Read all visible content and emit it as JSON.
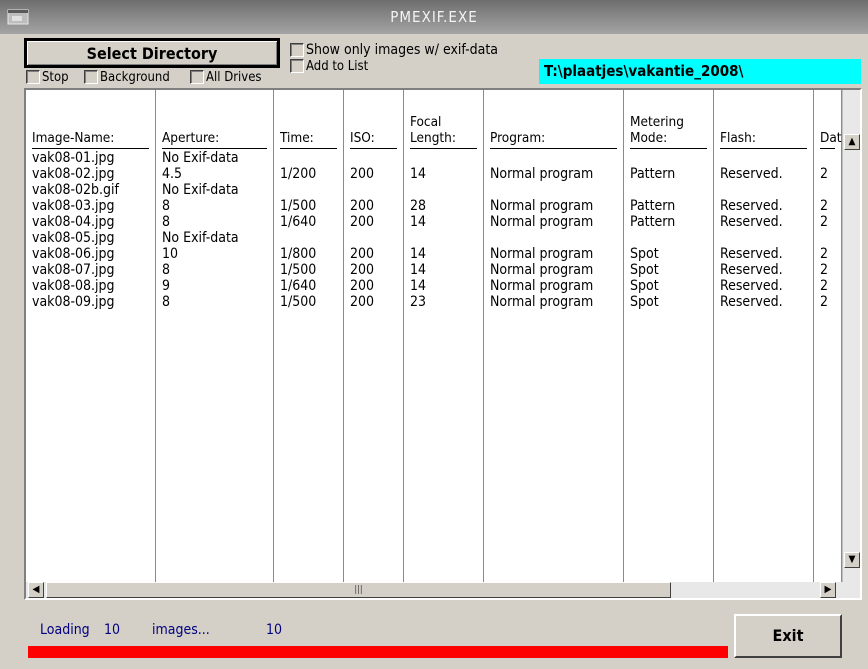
{
  "window": {
    "title": "PMEXIF.EXE"
  },
  "controls": {
    "select_directory": "Select Directory",
    "stop": "Stop",
    "background": "Background",
    "all_drives": "All Drives",
    "show_only_exif": "Show only images w/ exif-data",
    "add_to_list": "Add to List",
    "path": "T:\\plaatjes\\vakantie_2008\\"
  },
  "table": {
    "columns": [
      {
        "key": "name",
        "label": "Image-Name:"
      },
      {
        "key": "aperture",
        "label": "Aperture:"
      },
      {
        "key": "time",
        "label": "Time:"
      },
      {
        "key": "iso",
        "label": "ISO:"
      },
      {
        "key": "focal",
        "label": "Focal\nLength:"
      },
      {
        "key": "program",
        "label": "Program:"
      },
      {
        "key": "metering",
        "label": "Metering\nMode:"
      },
      {
        "key": "flash",
        "label": "Flash:"
      },
      {
        "key": "date",
        "label": "Date"
      }
    ],
    "rows": [
      {
        "name": "vak08-01.jpg",
        "aperture": "No Exif-data",
        "time": "",
        "iso": "",
        "focal": "",
        "program": "",
        "metering": "",
        "flash": "",
        "date": ""
      },
      {
        "name": "vak08-02.jpg",
        "aperture": "4.5",
        "time": "1/200",
        "iso": "200",
        "focal": "14",
        "program": "Normal program",
        "metering": "Pattern",
        "flash": "Reserved.",
        "date": "2"
      },
      {
        "name": "vak08-02b.gif",
        "aperture": "No Exif-data",
        "time": "",
        "iso": "",
        "focal": "",
        "program": "",
        "metering": "",
        "flash": "",
        "date": ""
      },
      {
        "name": "vak08-03.jpg",
        "aperture": "8",
        "time": "1/500",
        "iso": "200",
        "focal": "28",
        "program": "Normal program",
        "metering": "Pattern",
        "flash": "Reserved.",
        "date": "2"
      },
      {
        "name": "vak08-04.jpg",
        "aperture": "8",
        "time": "1/640",
        "iso": "200",
        "focal": "14",
        "program": "Normal program",
        "metering": "Pattern",
        "flash": "Reserved.",
        "date": "2"
      },
      {
        "name": "vak08-05.jpg",
        "aperture": "No Exif-data",
        "time": "",
        "iso": "",
        "focal": "",
        "program": "",
        "metering": "",
        "flash": "",
        "date": ""
      },
      {
        "name": "vak08-06.jpg",
        "aperture": "10",
        "time": "1/800",
        "iso": "200",
        "focal": "14",
        "program": "Normal program",
        "metering": "Spot",
        "flash": "Reserved.",
        "date": "2"
      },
      {
        "name": "vak08-07.jpg",
        "aperture": "8",
        "time": "1/500",
        "iso": "200",
        "focal": "14",
        "program": "Normal program",
        "metering": "Spot",
        "flash": "Reserved.",
        "date": "2"
      },
      {
        "name": "vak08-08.jpg",
        "aperture": "9",
        "time": "1/640",
        "iso": "200",
        "focal": "14",
        "program": "Normal program",
        "metering": "Spot",
        "flash": "Reserved.",
        "date": "2"
      },
      {
        "name": "vak08-09.jpg",
        "aperture": "8",
        "time": "1/500",
        "iso": "200",
        "focal": "23",
        "program": "Normal program",
        "metering": "Spot",
        "flash": "Reserved.",
        "date": "2"
      }
    ]
  },
  "status": {
    "loading": "Loading",
    "count1": "10",
    "images": "images...",
    "count2": "10",
    "progress_percent": 100,
    "progress_color": "#ff0000"
  },
  "exit_label": "Exit",
  "icons": {
    "app": "app-window-icon",
    "scroll_up": "arrow-up-icon",
    "scroll_down": "arrow-down-icon",
    "scroll_left": "arrow-left-icon",
    "scroll_right": "arrow-right-icon",
    "thumb_grip": "grip-icon"
  }
}
